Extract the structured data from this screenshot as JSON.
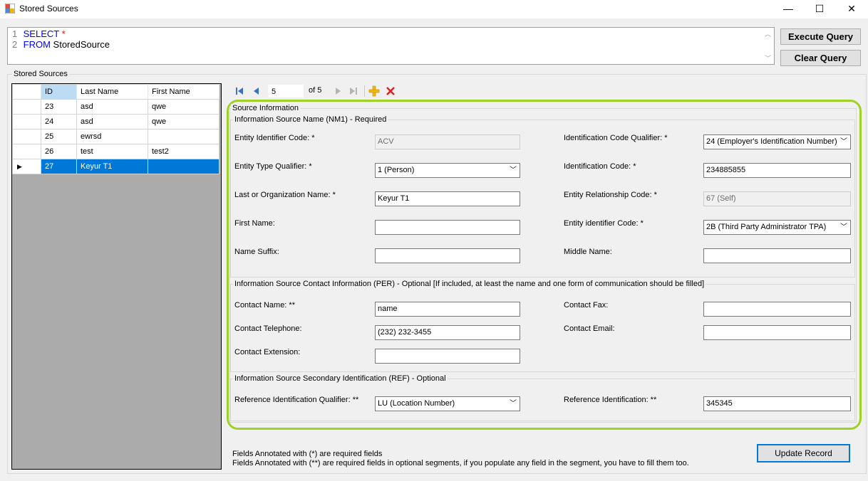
{
  "window": {
    "title": "Stored Sources",
    "minimize": "—",
    "maximize": "☐",
    "close": "✕"
  },
  "query": {
    "line1_num": "1",
    "line1_kw": "SELECT",
    "line1_rest": "*",
    "line2_num": "2",
    "line2_kw": "FROM",
    "line2_rest": "StoredSource"
  },
  "buttons": {
    "execute": "Execute Query",
    "clear": "Clear Query",
    "update": "Update Record"
  },
  "stored_group": "Stored Sources",
  "grid": {
    "headers": [
      "ID",
      "Last Name",
      "First Name"
    ],
    "rows": [
      {
        "id": "23",
        "last": "asd",
        "first": "qwe"
      },
      {
        "id": "24",
        "last": "asd",
        "first": "qwe"
      },
      {
        "id": "25",
        "last": "ewrsd",
        "first": ""
      },
      {
        "id": "26",
        "last": "test",
        "first": "test2"
      },
      {
        "id": "27",
        "last": "Keyur T1",
        "first": ""
      }
    ],
    "selected_index": 4
  },
  "navigator": {
    "position": "5",
    "count": "of 5"
  },
  "source_info": {
    "title": "Source Information",
    "nm1": {
      "title": "Information Source Name (NM1) - Required",
      "entity_identifier_code_label": "Entity Identifier Code: *",
      "entity_identifier_code": "ACV",
      "id_code_qualifier_label": "Identification Code Qualifier: *",
      "id_code_qualifier": "24 (Employer's Identification Number)",
      "entity_type_qualifier_label": "Entity Type Qualifier: *",
      "entity_type_qualifier": "1 (Person)",
      "identification_code_label": "Identification Code: *",
      "identification_code": "234885855",
      "last_org_name_label": "Last or Organization Name: *",
      "last_org_name": "Keyur T1",
      "entity_relationship_label": "Entity Relationship Code: *",
      "entity_relationship": "67 (Self)",
      "first_name_label": "First Name:",
      "first_name": "",
      "entity_identifier_code2_label": "Entity identifier Code: *",
      "entity_identifier_code2": "2B (Third Party Administrator TPA)",
      "name_suffix_label": "Name Suffix:",
      "name_suffix": "",
      "middle_name_label": "Middle Name:",
      "middle_name": ""
    },
    "per": {
      "title": "Information Source Contact Information (PER) - Optional [If included, at least the name and one form of communication should be filled]",
      "contact_name_label": "Contact Name: **",
      "contact_name": "name",
      "contact_fax_label": "Contact Fax:",
      "contact_fax": "",
      "contact_phone_label": "Contact Telephone:",
      "contact_phone": "(232) 232-3455",
      "contact_email_label": "Contact Email:",
      "contact_email": "",
      "contact_ext_label": "Contact Extension:",
      "contact_ext": ""
    },
    "ref": {
      "title": "Information Source Secondary Identification (REF) - Optional",
      "ref_qualifier_label": "Reference Identification Qualifier: **",
      "ref_qualifier": "LU (Location Number)",
      "ref_id_label": "Reference Identification: **",
      "ref_id": "345345"
    }
  },
  "notes": {
    "line1": "Fields Annotated with (*) are required fields",
    "line2": "Fields Annotated with (**) are required fields in optional segments, if you populate any field in the segment, you have to fill them too."
  },
  "colors": {
    "accent_green": "#9fd127",
    "selection": "#0078d7"
  }
}
